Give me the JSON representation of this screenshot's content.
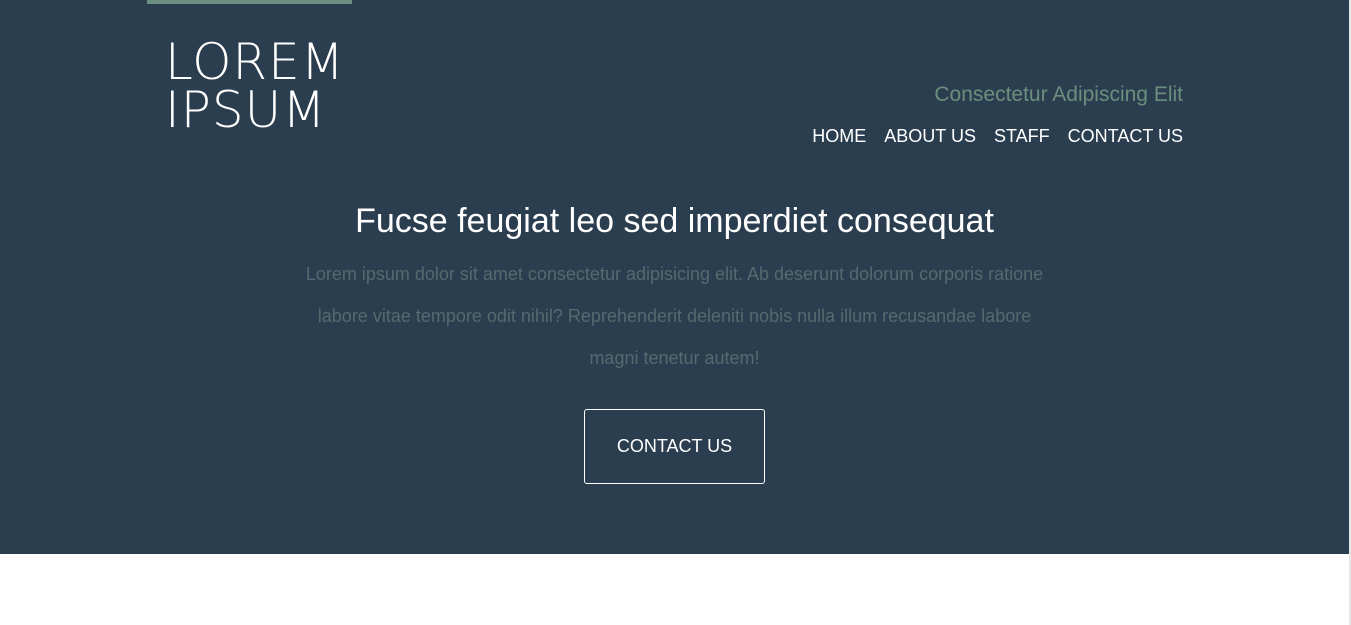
{
  "brand": {
    "logo_line1": "LOREM",
    "logo_line2": "IPSUM",
    "tagline": "Consectetur Adipiscing Elit"
  },
  "nav": {
    "items": [
      {
        "label": "HOME"
      },
      {
        "label": "ABOUT US"
      },
      {
        "label": "STAFF"
      },
      {
        "label": "CONTACT US"
      }
    ]
  },
  "hero": {
    "headline": "Fucse feugiat leo sed imperdiet consequat",
    "intro": "Lorem ipsum dolor sit amet consectetur adipisicing elit. Ab deserunt dolorum corporis ratione labore vitae tempore odit nihil? Reprehenderit deleniti nobis nulla illum recusandae labore magni tenetur autem!",
    "cta_label": "CONTACT US"
  },
  "colors": {
    "hero_background": "#2b3e4f",
    "accent": "#6b8f7e",
    "intro_text": "#55696f",
    "text": "#ffffff"
  }
}
